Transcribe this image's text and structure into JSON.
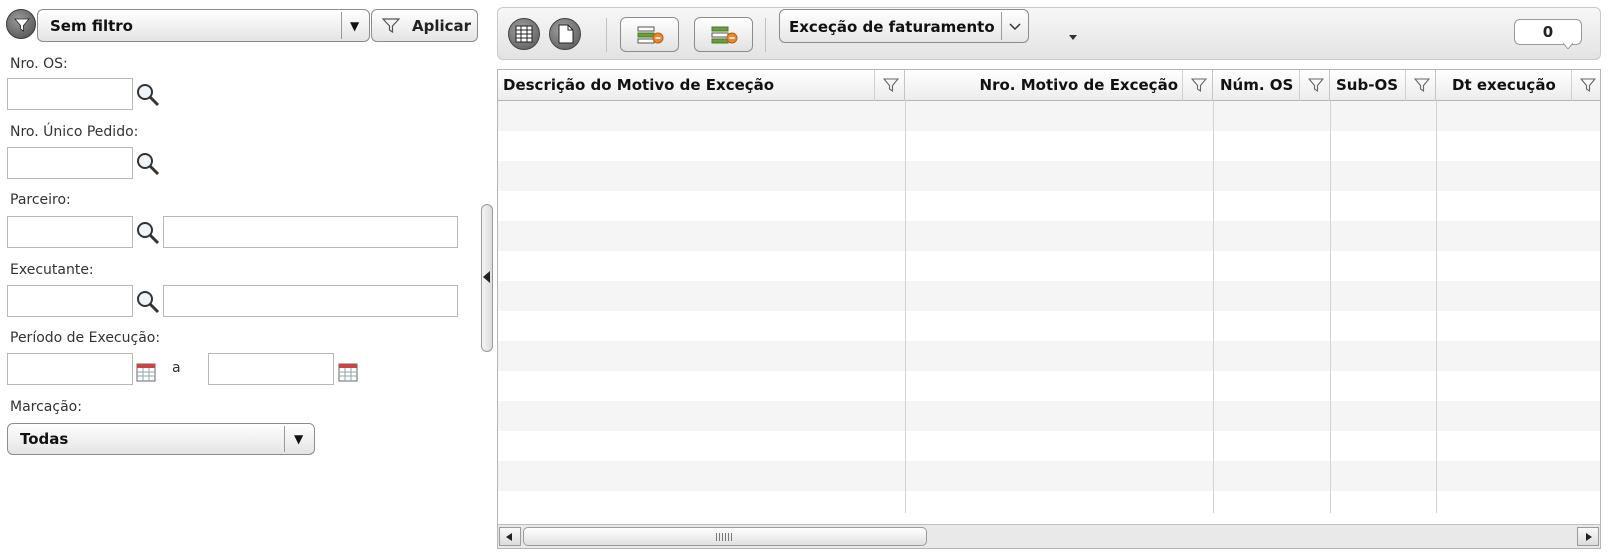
{
  "filter": {
    "preset_select": {
      "value": "Sem filtro"
    },
    "apply_label": "Aplicar",
    "fields": {
      "nro_os_label": "Nro. OS:",
      "nro_unico_pedido_label": "Nro. Único Pedido:",
      "parceiro_label": "Parceiro:",
      "executante_label": "Executante:",
      "periodo_label": "Período de Execução:",
      "periodo_separator": "a",
      "marcacao_label": "Marcação:",
      "marcacao_value": "Todas"
    }
  },
  "toolbar": {
    "config_select_value": "Exceção de faturamento",
    "record_count": "0"
  },
  "grid": {
    "columns": [
      {
        "label": "Descrição do Motivo de Exceção"
      },
      {
        "label": "Nro. Motivo de Exceção"
      },
      {
        "label": "Núm. OS"
      },
      {
        "label": "Sub-OS"
      },
      {
        "label": "Dt execução"
      }
    ],
    "rows": []
  },
  "icons": {
    "filter_menu": "filter-icon",
    "lookup": "magnifier-icon",
    "calendar": "calendar-icon",
    "grid_view": "grid-icon",
    "export": "export-icon",
    "column_filter": "funnel-icon"
  }
}
